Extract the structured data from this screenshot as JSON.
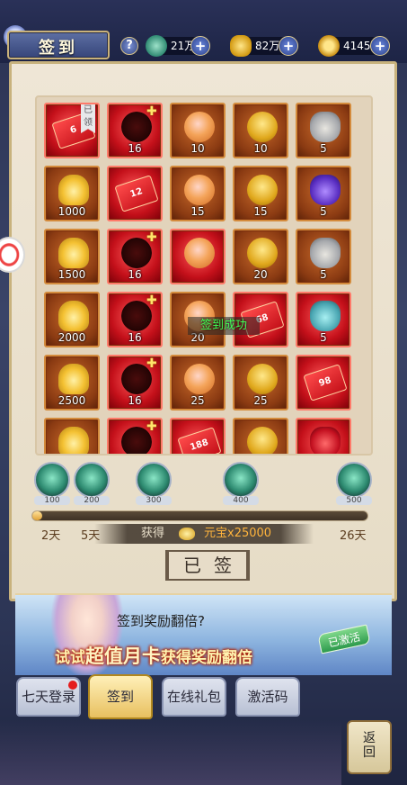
{
  "header": {
    "title": "签到",
    "help_icon": "?",
    "resources": [
      {
        "name": "jade",
        "icon": "jade-icon",
        "value": "21万"
      },
      {
        "name": "gold_ingot",
        "icon": "gold-ingot-icon",
        "value": "82万"
      },
      {
        "name": "coin",
        "icon": "coin-icon",
        "value": "4145万"
      }
    ],
    "plus_label": "+"
  },
  "grid": {
    "cells": [
      {
        "item": "envelope",
        "count": "6",
        "red": true,
        "signed_tag": "已领"
      },
      {
        "item": "wing",
        "count": "16",
        "red": true,
        "star": true
      },
      {
        "item": "peach",
        "count": "10",
        "red": false
      },
      {
        "item": "token",
        "count": "10",
        "red": false
      },
      {
        "item": "bag",
        "count": "5",
        "red": false
      },
      {
        "item": "gold",
        "count": "1000",
        "red": false
      },
      {
        "item": "envelope",
        "count": "12",
        "red": true
      },
      {
        "item": "peach",
        "count": "15",
        "red": false
      },
      {
        "item": "token",
        "count": "15",
        "red": false
      },
      {
        "item": "bag-purple",
        "count": "5",
        "red": false
      },
      {
        "item": "gold",
        "count": "1500",
        "red": false
      },
      {
        "item": "wing",
        "count": "16",
        "red": true,
        "star": true
      },
      {
        "item": "peach",
        "count": "",
        "red": true
      },
      {
        "item": "token",
        "count": "20",
        "red": false
      },
      {
        "item": "bag",
        "count": "5",
        "red": false
      },
      {
        "item": "gold",
        "count": "2000",
        "red": false
      },
      {
        "item": "wing",
        "count": "16",
        "red": true,
        "star": true
      },
      {
        "item": "peach",
        "count": "20",
        "red": false
      },
      {
        "item": "envelope",
        "count": "68",
        "red": true
      },
      {
        "item": "bag-jade",
        "count": "5",
        "red": true
      },
      {
        "item": "gold",
        "count": "2500",
        "red": false
      },
      {
        "item": "wing",
        "count": "16",
        "red": true,
        "star": true
      },
      {
        "item": "peach",
        "count": "25",
        "red": false
      },
      {
        "item": "token",
        "count": "25",
        "red": false
      },
      {
        "item": "envelope",
        "count": "98",
        "red": true
      },
      {
        "item": "gold",
        "count": "",
        "red": false
      },
      {
        "item": "wing",
        "count": "",
        "red": true,
        "star": true
      },
      {
        "item": "envelope",
        "count": "188",
        "red": true
      },
      {
        "item": "token",
        "count": "",
        "red": false
      },
      {
        "item": "red-bag",
        "count": "",
        "red": true
      }
    ],
    "toast": "签到成功"
  },
  "progress": {
    "milestones": [
      "100",
      "200",
      "300",
      "400",
      "500"
    ],
    "fraction": 0.03,
    "days": [
      "2天",
      "5天",
      "26天"
    ],
    "reward_prefix": "获得",
    "reward_amount": "元宝x25000",
    "signed_button": "已签"
  },
  "banner": {
    "question": "签到奖励翻倍?",
    "promo_a": "试试",
    "promo_big": "超值月卡",
    "promo_b": "获得奖励翻倍",
    "activated": "已激活"
  },
  "tabs": [
    {
      "label": "七天登录",
      "active": false,
      "dot": true
    },
    {
      "label": "签到",
      "active": true,
      "dot": false
    },
    {
      "label": "在线礼包",
      "active": false,
      "dot": false
    },
    {
      "label": "激活码",
      "active": false,
      "dot": false
    }
  ],
  "back_label": "返回",
  "colors": {
    "accent_gold": "#e0a236",
    "toast_green": "#44ff55",
    "reward_orange": "#ffb43c"
  }
}
